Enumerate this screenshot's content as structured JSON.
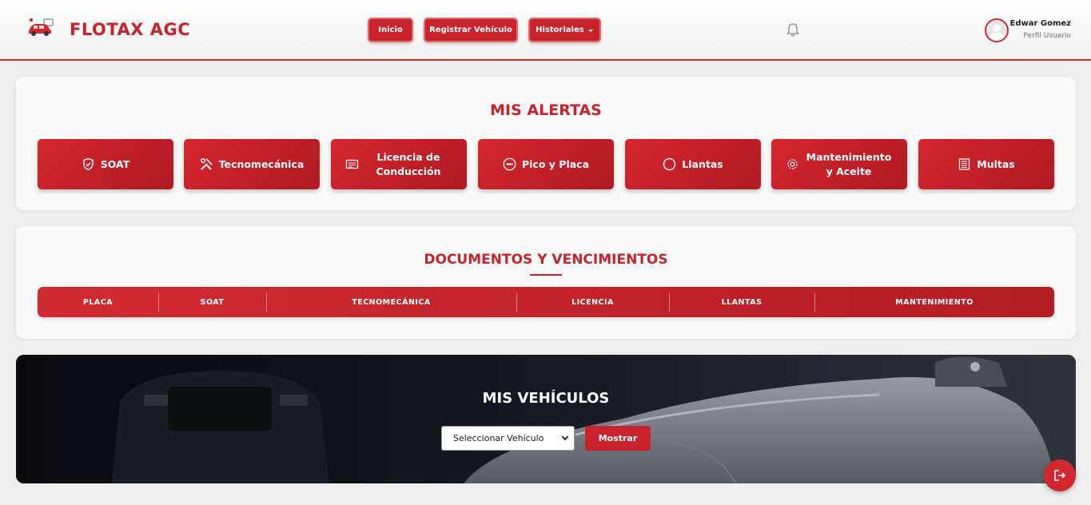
{
  "header": {
    "brand": "FLOTAX AGC",
    "nav": {
      "home": "Inicio",
      "register": "Registrar Vehículo",
      "history": "Historiales"
    },
    "user": {
      "name": "Edwar Gomez",
      "subtitle": "Perfil Usuario"
    },
    "icons": {
      "logo": "car-logo-icon",
      "bell": "bell-icon",
      "avatar": "user-avatar-icon"
    }
  },
  "alerts": {
    "title": "MIS ALERTAS",
    "items": [
      {
        "label": "SOAT",
        "icon": "shield-check-icon"
      },
      {
        "label": "Tecnomecánica",
        "icon": "tools-icon"
      },
      {
        "label": "Licencia de Conducción",
        "icon": "id-card-icon"
      },
      {
        "label": "Pico y Placa",
        "icon": "stop-sign-icon"
      },
      {
        "label": "Llantas",
        "icon": "circle-icon"
      },
      {
        "label": "Mantenimiento y Aceite",
        "icon": "gear-icon"
      },
      {
        "label": "Multas",
        "icon": "receipt-icon"
      }
    ]
  },
  "documents": {
    "title": "DOCUMENTOS Y VENCIMIENTOS",
    "columns": [
      "PLACA",
      "SOAT",
      "TECNOMECÁNICA",
      "LICENCIA",
      "LLANTAS",
      "MANTENIMIENTO"
    ]
  },
  "vehicles": {
    "title": "MIS VEHÍCULOS",
    "select_value": "Seleccionar Vehículo",
    "show_button": "Mostrar"
  },
  "fab": {
    "icon": "logout-icon"
  },
  "colors": {
    "accent": "#c8232c",
    "background": "#eeeeee",
    "card": "#fafafa"
  }
}
